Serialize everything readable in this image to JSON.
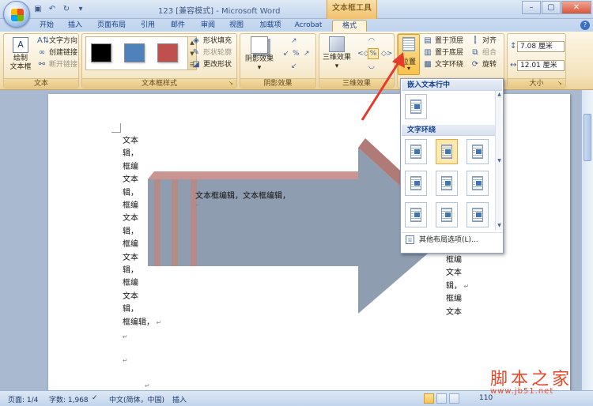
{
  "titlebar": {
    "doc_title": "123 [兼容模式] - Microsoft Word",
    "contextual_tab": "文本框工具"
  },
  "tabs": [
    "开始",
    "插入",
    "页面布局",
    "引用",
    "邮件",
    "审阅",
    "视图",
    "加载项",
    "Acrobat",
    "格式"
  ],
  "active_tab": "格式",
  "ribbon": {
    "text_group": {
      "draw_textbox": "绘制\n文本框",
      "text_direction": "文字方向",
      "create_link": "创建链接",
      "break_link": "断开链接",
      "label": "文本"
    },
    "styles_group": {
      "shape_fill": "形状填充",
      "shape_outline": "形状轮廓",
      "change_shape": "更改形状",
      "label": "文本框样式",
      "swatches": [
        "#000000",
        "#4f81bd",
        "#c0504d"
      ]
    },
    "shadow_group": {
      "button": "阴影效果",
      "label": "阴影效果"
    },
    "three_d_group": {
      "button": "三维效果",
      "label": "三维效果"
    },
    "arrange_group": {
      "position": "位置",
      "bring_front": "置于顶层",
      "send_back": "置于底层",
      "text_wrap": "文字环绕",
      "align": "对齐",
      "group": "组合",
      "rotate": "旋转"
    },
    "size_group": {
      "height": "7.08 厘米",
      "width": "12.01 厘米",
      "label": "大小"
    }
  },
  "document": {
    "left_column": [
      "文本",
      "辑，",
      "框编",
      "文本",
      "辑，",
      "框编",
      "文本",
      "辑，",
      "框编",
      "文本",
      "辑，",
      "框编",
      "文本",
      "辑，",
      "框编辑，"
    ],
    "arrow_text": "文本框编辑，文本框编辑，",
    "right_column": [
      "框编",
      "文本",
      "辑，",
      "框编",
      "文本"
    ]
  },
  "position_dropdown": {
    "inline_header": "嵌入文本行中",
    "wrap_header": "文字环绕",
    "more_options": "其他布局选项(L)..."
  },
  "statusbar": {
    "page": "页面: 1/4",
    "words": "字数: 1,968",
    "language": "中文(简体，中国)",
    "mode": "插入",
    "zoom": "110"
  },
  "watermark": {
    "text": "脚本之家",
    "url": "www.jb51.net"
  }
}
